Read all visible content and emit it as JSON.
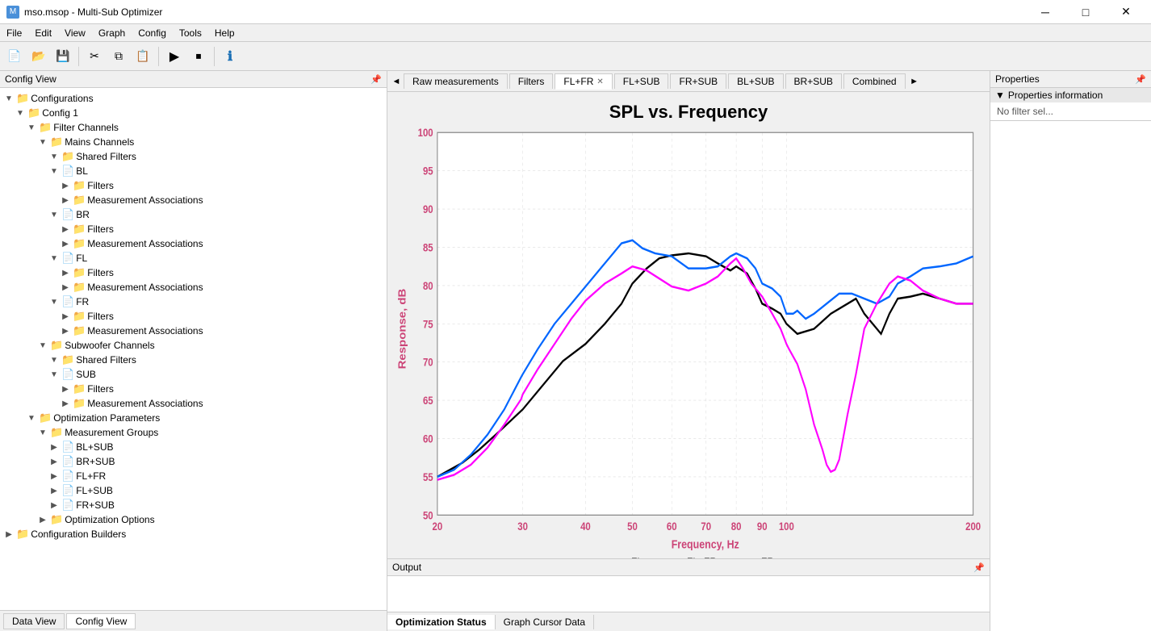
{
  "titleBar": {
    "icon": "M",
    "title": "mso.msop - Multi-Sub Optimizer",
    "controls": [
      "─",
      "□",
      "✕"
    ]
  },
  "menuBar": {
    "items": [
      "File",
      "Edit",
      "View",
      "Graph",
      "Config",
      "Tools",
      "Help"
    ]
  },
  "toolbar": {
    "buttons": [
      "📄",
      "📂",
      "💾",
      "✂️",
      "📋",
      "📋",
      "▶",
      "⏹",
      "ℹ️"
    ]
  },
  "leftPanel": {
    "title": "Config View",
    "tree": [
      {
        "level": 0,
        "expanded": true,
        "type": "folder",
        "label": "Configurations"
      },
      {
        "level": 1,
        "expanded": true,
        "type": "folder",
        "label": "Config 1"
      },
      {
        "level": 2,
        "expanded": true,
        "type": "folder",
        "label": "Filter Channels"
      },
      {
        "level": 3,
        "expanded": true,
        "type": "folder",
        "label": "Mains Channels"
      },
      {
        "level": 4,
        "expanded": true,
        "type": "folder",
        "label": "Shared Filters"
      },
      {
        "level": 4,
        "expanded": true,
        "type": "doc",
        "label": "BL"
      },
      {
        "level": 5,
        "expanded": false,
        "type": "folder",
        "label": "Filters"
      },
      {
        "level": 5,
        "expanded": false,
        "type": "folder",
        "label": "Measurement Associations"
      },
      {
        "level": 4,
        "expanded": true,
        "type": "doc",
        "label": "BR"
      },
      {
        "level": 5,
        "expanded": false,
        "type": "folder",
        "label": "Filters"
      },
      {
        "level": 5,
        "expanded": false,
        "type": "folder",
        "label": "Measurement Associations"
      },
      {
        "level": 4,
        "expanded": true,
        "type": "doc",
        "label": "FL"
      },
      {
        "level": 5,
        "expanded": false,
        "type": "folder",
        "label": "Filters"
      },
      {
        "level": 5,
        "expanded": false,
        "type": "folder",
        "label": "Measurement Associations"
      },
      {
        "level": 4,
        "expanded": true,
        "type": "doc",
        "label": "FR"
      },
      {
        "level": 5,
        "expanded": false,
        "type": "folder",
        "label": "Filters"
      },
      {
        "level": 5,
        "expanded": false,
        "type": "folder",
        "label": "Measurement Associations"
      },
      {
        "level": 3,
        "expanded": true,
        "type": "folder",
        "label": "Subwoofer Channels"
      },
      {
        "level": 4,
        "expanded": true,
        "type": "folder",
        "label": "Shared Filters"
      },
      {
        "level": 4,
        "expanded": true,
        "type": "doc",
        "label": "SUB"
      },
      {
        "level": 5,
        "expanded": false,
        "type": "folder",
        "label": "Filters"
      },
      {
        "level": 5,
        "expanded": false,
        "type": "folder",
        "label": "Measurement Associations"
      },
      {
        "level": 2,
        "expanded": true,
        "type": "folder",
        "label": "Optimization Parameters"
      },
      {
        "level": 3,
        "expanded": true,
        "type": "folder",
        "label": "Measurement Groups"
      },
      {
        "level": 4,
        "expanded": false,
        "type": "doc",
        "label": "BL+SUB"
      },
      {
        "level": 4,
        "expanded": false,
        "type": "doc",
        "label": "BR+SUB"
      },
      {
        "level": 4,
        "expanded": false,
        "type": "doc",
        "label": "FL+FR"
      },
      {
        "level": 4,
        "expanded": false,
        "type": "doc",
        "label": "FL+SUB"
      },
      {
        "level": 4,
        "expanded": false,
        "type": "doc",
        "label": "FR+SUB"
      },
      {
        "level": 3,
        "expanded": false,
        "type": "folder",
        "label": "Optimization Options"
      },
      {
        "level": 0,
        "expanded": false,
        "type": "folder",
        "label": "Configuration Builders"
      }
    ]
  },
  "tabs": {
    "items": [
      {
        "label": "Raw measurements",
        "active": false,
        "closeable": false
      },
      {
        "label": "Filters",
        "active": false,
        "closeable": false
      },
      {
        "label": "FL+FR",
        "active": true,
        "closeable": true
      },
      {
        "label": "FL+SUB",
        "active": false,
        "closeable": false
      },
      {
        "label": "FR+SUB",
        "active": false,
        "closeable": false
      },
      {
        "label": "BL+SUB",
        "active": false,
        "closeable": false
      },
      {
        "label": "BR+SUB",
        "active": false,
        "closeable": false
      },
      {
        "label": "Combined",
        "active": false,
        "closeable": false
      }
    ]
  },
  "chart": {
    "title": "SPL vs. Frequency",
    "xLabel": "Frequency, Hz",
    "yLabel": "Response, dB",
    "xMin": 20,
    "xMax": 200,
    "yMin": 50,
    "yMax": 100,
    "xTicks": [
      20,
      30,
      40,
      50,
      60,
      70,
      80,
      90,
      100,
      200
    ],
    "yTicks": [
      50,
      55,
      60,
      65,
      70,
      75,
      80,
      85,
      90,
      95,
      100
    ],
    "legend": [
      {
        "color": "#000000",
        "label": "FL"
      },
      {
        "color": "#0066ff",
        "label": "FL+FR"
      },
      {
        "color": "#ff00ff",
        "label": "FR"
      }
    ]
  },
  "output": {
    "title": "Output"
  },
  "outputTabs": {
    "items": [
      {
        "label": "Optimization Status",
        "active": true
      },
      {
        "label": "Graph Cursor Data",
        "active": false
      }
    ]
  },
  "properties": {
    "title": "Properties",
    "section": "Properties information",
    "content": "No filter sel..."
  },
  "bottomTabs": {
    "items": [
      {
        "label": "Data View",
        "active": false
      },
      {
        "label": "Config View",
        "active": true
      }
    ]
  }
}
